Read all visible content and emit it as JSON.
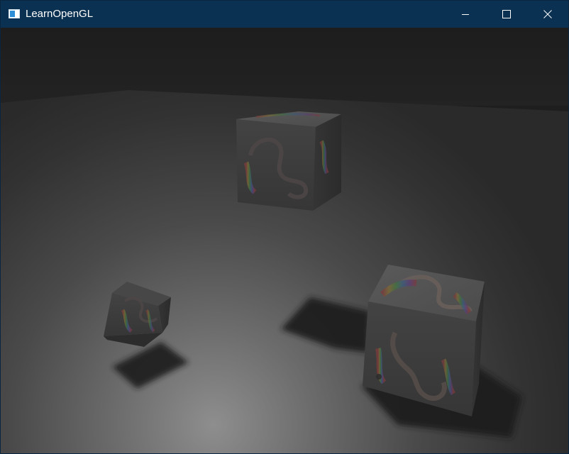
{
  "window": {
    "title": "LearnOpenGL",
    "controls": {
      "minimize_icon": "minimize-icon",
      "maximize_icon": "maximize-icon",
      "close_icon": "close-icon"
    }
  },
  "colors": {
    "titlebar": "#0b3152",
    "background_wall": "#1e1e1e",
    "floor_light": "#8a8a8a",
    "floor_dark": "#2a2a2a",
    "shadow": "#1c1c1c"
  }
}
